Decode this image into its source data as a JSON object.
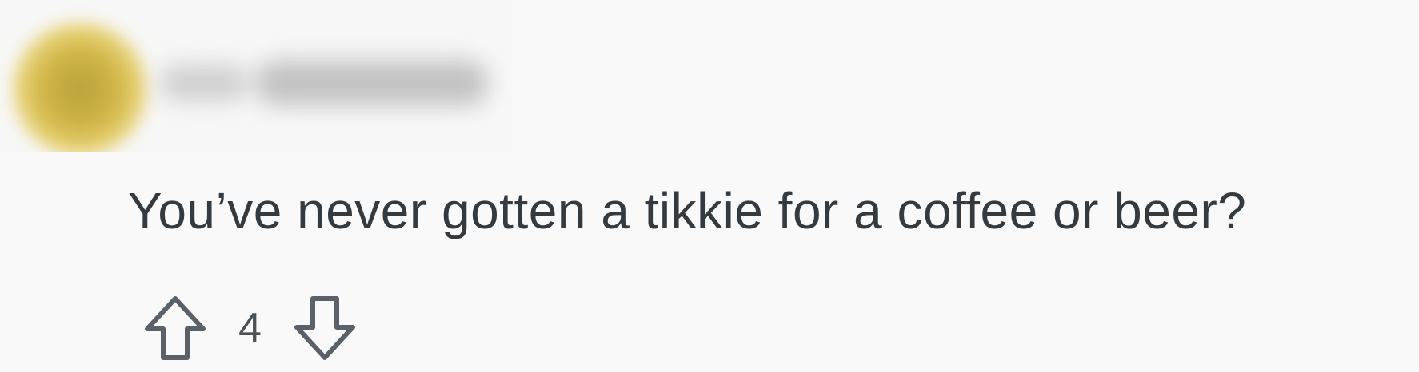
{
  "comment": {
    "author": "",
    "text": "You’ve never gotten a tikkie for a coffee or beer?",
    "score": "4"
  },
  "icons": {
    "upvote": "arrow-up-outline-icon",
    "downvote": "arrow-down-outline-icon",
    "avatar": "avatar-image-blurred"
  },
  "colors": {
    "background": "#f9f9f9",
    "text": "#333a40",
    "icon": "#5a6168"
  }
}
